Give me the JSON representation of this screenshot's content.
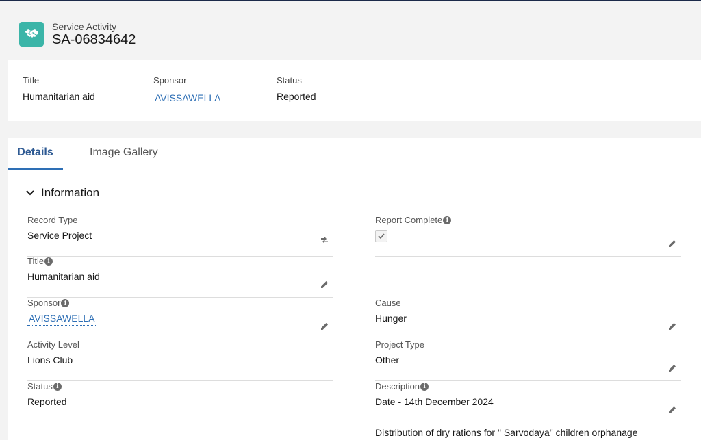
{
  "header": {
    "object_label": "Service Activity",
    "record_name": "SA-06834642",
    "icon": "handshake-icon"
  },
  "highlights": {
    "title_label": "Title",
    "title_value": "Humanitarian aid",
    "sponsor_label": "Sponsor",
    "sponsor_value": "AVISSAWELLA",
    "status_label": "Status",
    "status_value": "Reported"
  },
  "tabs": [
    {
      "label": "Details",
      "active": true
    },
    {
      "label": "Image Gallery",
      "active": false
    }
  ],
  "section": {
    "title": "Information",
    "icon": "chevron-down-icon"
  },
  "fields": {
    "record_type": {
      "label": "Record Type",
      "value": "Service Project"
    },
    "report_complete": {
      "label": "Report Complete",
      "checked": true
    },
    "title": {
      "label": "Title",
      "value": "Humanitarian aid"
    },
    "sponsor": {
      "label": "Sponsor",
      "value": "AVISSAWELLA"
    },
    "cause": {
      "label": "Cause",
      "value": "Hunger"
    },
    "activity_level": {
      "label": "Activity Level",
      "value": "Lions Club"
    },
    "project_type": {
      "label": "Project Type",
      "value": "Other"
    },
    "status": {
      "label": "Status",
      "value": "Reported"
    },
    "description": {
      "label": "Description",
      "value_line1": "Date - 14th December 2024",
      "value_line2": "Distribution of dry rations for \" Sarvodaya\" children orphanage"
    }
  },
  "colors": {
    "accent": "#2e6fb5",
    "app_icon_bg": "#3bb5a8",
    "top_bar": "#1b2a4a"
  }
}
